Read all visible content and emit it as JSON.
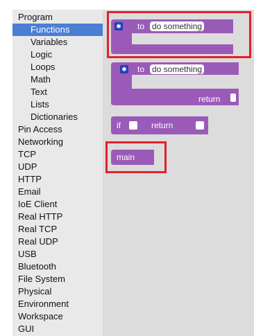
{
  "sidebar": {
    "items": [
      {
        "label": "Program"
      },
      {
        "label": "Functions"
      },
      {
        "label": "Variables"
      },
      {
        "label": "Logic"
      },
      {
        "label": "Loops"
      },
      {
        "label": "Math"
      },
      {
        "label": "Text"
      },
      {
        "label": "Lists"
      },
      {
        "label": "Dictionaries"
      },
      {
        "label": "Pin Access"
      },
      {
        "label": "Networking"
      },
      {
        "label": "TCP"
      },
      {
        "label": "UDP"
      },
      {
        "label": "HTTP"
      },
      {
        "label": "Email"
      },
      {
        "label": "IoE Client"
      },
      {
        "label": "Real HTTP"
      },
      {
        "label": "Real TCP"
      },
      {
        "label": "Real UDP"
      },
      {
        "label": "USB"
      },
      {
        "label": "Bluetooth"
      },
      {
        "label": "File System"
      },
      {
        "label": "Physical"
      },
      {
        "label": "Environment"
      },
      {
        "label": "Workspace"
      },
      {
        "label": "GUI"
      }
    ],
    "selected": "Functions"
  },
  "blocks": {
    "procedure_no_return": {
      "to_label": "to",
      "name_field": "do something"
    },
    "procedure_with_return": {
      "to_label": "to",
      "name_field": "do something",
      "return_label": "return"
    },
    "if_return": {
      "if_label": "if",
      "return_label": "return"
    },
    "main_call": {
      "label": "main"
    }
  },
  "colors": {
    "block": "#9a5bb8",
    "highlight": "#e0212b",
    "selected_bg": "#4a7fd4",
    "mutator": "#1f3fb8"
  }
}
